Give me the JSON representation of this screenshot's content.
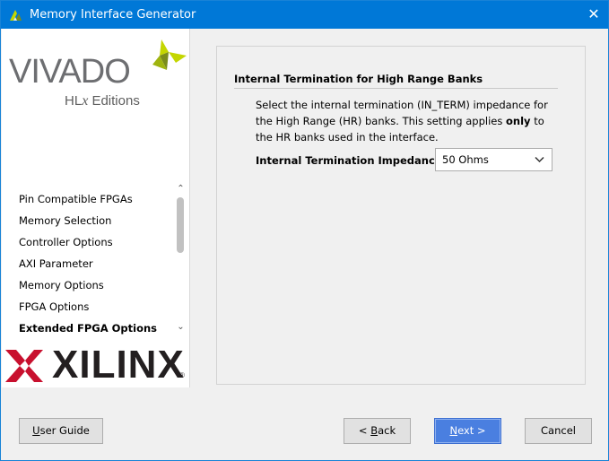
{
  "window": {
    "title": "Memory Interface Generator",
    "close_label": "✕",
    "app_icon": "vivado-icon"
  },
  "branding": {
    "vivado": "VIVADO",
    "hlx_prefix": "HL",
    "hlx_x": "x",
    "hlx_suffix": " Editions",
    "xilinx": "XILINX",
    "registered": "®"
  },
  "nav": {
    "items": [
      {
        "label": "Pin Compatible FPGAs",
        "active": false
      },
      {
        "label": "Memory Selection",
        "active": false
      },
      {
        "label": "Controller Options",
        "active": false
      },
      {
        "label": "AXI Parameter",
        "active": false
      },
      {
        "label": "Memory Options",
        "active": false
      },
      {
        "label": "FPGA Options",
        "active": false
      },
      {
        "label": "Extended FPGA Options",
        "active": true
      }
    ],
    "scroll_up": "⌃",
    "scroll_down": "⌄"
  },
  "main": {
    "section_title": "Internal Termination for High Range Banks",
    "desc_1": "Select the internal termination (IN_TERM) impedance for the High Range (HR) banks. This setting applies ",
    "desc_bold": "only",
    "desc_2": " to the HR banks used in the interface.",
    "field_label": "Internal Termination Impedance",
    "impedance_value": "50 Ohms"
  },
  "buttons": {
    "user_guide": {
      "u": "U",
      "rest": "ser Guide"
    },
    "back": {
      "pre": "< ",
      "u": "B",
      "rest": "ack"
    },
    "next": {
      "u": "N",
      "rest": "ext >"
    },
    "cancel": "Cancel"
  },
  "colors": {
    "titlebar": "#0078d7",
    "vivado_leaf_light": "#c4d600",
    "vivado_leaf_dark": "#7a8c1b",
    "xilinx_red": "#c8102e",
    "next_button": "#4a7fe0"
  }
}
